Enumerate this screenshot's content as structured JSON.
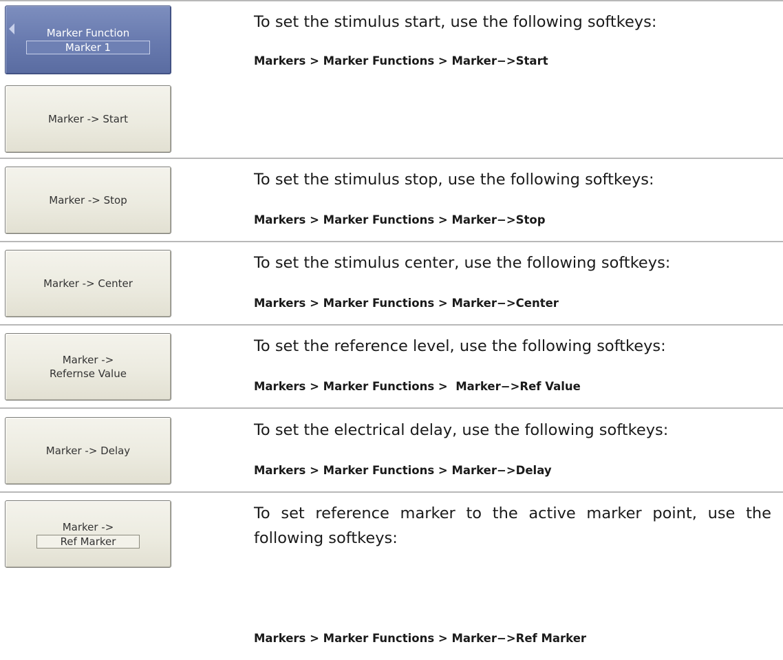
{
  "sections": [
    {
      "keys": [
        {
          "label": "Marker Function",
          "field": "Marker 1"
        },
        {
          "label": "Marker -> Start"
        }
      ],
      "description": "To set the stimulus start, use the following softkeys:",
      "path": "Markers > Marker Functions > Marker−>Start"
    },
    {
      "keys": [
        {
          "label": "Marker -> Stop"
        }
      ],
      "description": "To set the stimulus stop, use the following softkeys:",
      "path": "Markers > Marker Functions > Marker−>Stop"
    },
    {
      "keys": [
        {
          "label": "Marker -> Center"
        }
      ],
      "description": "To set the stimulus center, use the following softkeys:",
      "path": "Markers > Marker Functions > Marker−>Center"
    },
    {
      "keys": [
        {
          "line1": "Marker ->",
          "line2": "Refernse Value"
        }
      ],
      "description": "To set the reference level, use the following softkeys:",
      "path": "Markers > Marker Functions >  Marker−>Ref Value"
    },
    {
      "keys": [
        {
          "label": "Marker -> Delay"
        }
      ],
      "description": "To set the electrical delay, use the following softkeys:",
      "path": "Markers > Marker Functions > Marker−>Delay"
    },
    {
      "keys": [
        {
          "line1": "Marker ->",
          "field": "Ref Marker"
        }
      ],
      "description": "To set reference marker to the active marker point, use the following softkeys:",
      "path": "Markers > Marker Functions > Marker−>Ref Marker"
    }
  ]
}
